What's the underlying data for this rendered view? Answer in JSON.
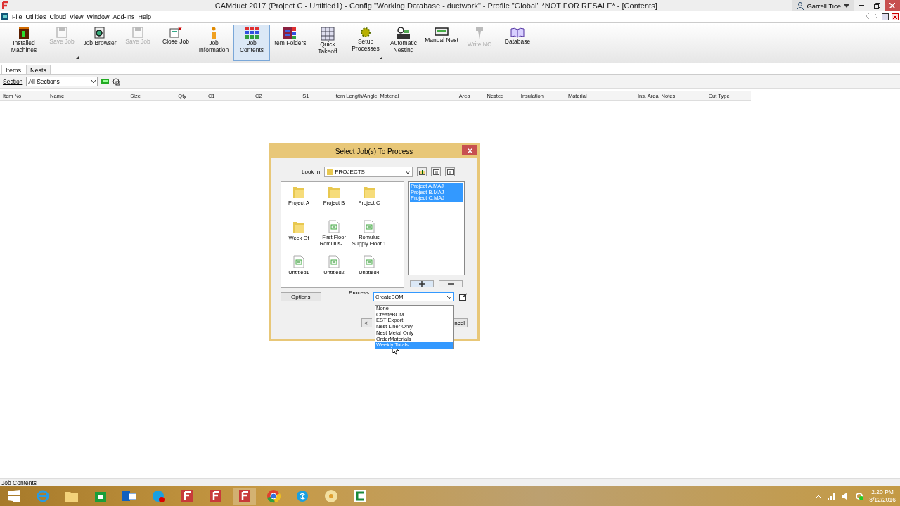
{
  "window": {
    "title": "CAMduct 2017 (Project C - Untitled1) - Config \"Working Database - ductwork\" - Profile \"Global\" *NOT FOR RESALE* - [Contents]",
    "user": "Garrell Tice"
  },
  "menu": [
    "File",
    "Utilities",
    "Cloud",
    "View",
    "Window",
    "Add-Ins",
    "Help"
  ],
  "toolbar": [
    {
      "label": "Installed Machines",
      "kind": "machine",
      "disabled": false,
      "selected": false,
      "dropdown": false
    },
    {
      "label": "Save Job",
      "kind": "save",
      "disabled": true,
      "selected": false,
      "dropdown": true
    },
    {
      "label": "Job Browser",
      "kind": "browser",
      "disabled": false,
      "selected": false,
      "dropdown": false
    },
    {
      "label": "Save Job",
      "kind": "save",
      "disabled": true,
      "selected": false,
      "dropdown": false
    },
    {
      "label": "Close Job",
      "kind": "close",
      "disabled": false,
      "selected": false,
      "dropdown": false
    },
    {
      "label": "Job Information",
      "kind": "info",
      "disabled": false,
      "selected": false,
      "dropdown": false
    },
    {
      "label": "Job Contents",
      "kind": "grid",
      "disabled": false,
      "selected": true,
      "dropdown": false
    },
    {
      "label": "Item Folders",
      "kind": "folders",
      "disabled": false,
      "selected": false,
      "dropdown": false
    },
    {
      "label": "Quick Takeoff",
      "kind": "takeoff",
      "disabled": false,
      "selected": false,
      "dropdown": false
    },
    {
      "label": "Setup Processes",
      "kind": "gear",
      "disabled": false,
      "selected": false,
      "dropdown": true
    },
    {
      "label": "Automatic Nesting",
      "kind": "nesting",
      "disabled": false,
      "selected": false,
      "dropdown": false
    },
    {
      "label": "Manual Nest",
      "kind": "manual",
      "disabled": false,
      "selected": false,
      "dropdown": false
    },
    {
      "label": "Write NC",
      "kind": "nc",
      "disabled": true,
      "selected": false,
      "dropdown": false
    },
    {
      "label": "Database",
      "kind": "database",
      "disabled": false,
      "selected": false,
      "dropdown": false
    }
  ],
  "tabs": [
    {
      "label": "Items",
      "selected": true
    },
    {
      "label": "Nests",
      "selected": false
    }
  ],
  "section": {
    "label": "Section",
    "value": "All Sections"
  },
  "columns": [
    "Item No",
    "Name",
    "Size",
    "Qty",
    "C1",
    "C2",
    "S1",
    "Item Length/Angle",
    "Material",
    "Area",
    "Nested",
    "Insulation",
    "Material",
    "Ins. Area",
    "Notes",
    "Cut Type"
  ],
  "dialog": {
    "title": "Select Job(s) To Process",
    "look_in_label": "Look In",
    "look_in_value": "PROJECTS",
    "files": [
      {
        "label": "Project A",
        "kind": "folder"
      },
      {
        "label": "Project B",
        "kind": "folder"
      },
      {
        "label": "Project C",
        "kind": "folder"
      },
      {
        "label": "Week Of",
        "kind": "folder"
      },
      {
        "label": "First Floor Romulus- ...",
        "kind": "job"
      },
      {
        "label": "Romulus Supply Floor 1",
        "kind": "job"
      },
      {
        "label": "Untitled1",
        "kind": "job"
      },
      {
        "label": "Untitled2",
        "kind": "job"
      },
      {
        "label": "Untitled4",
        "kind": "job"
      }
    ],
    "selected_jobs": [
      {
        "label": "Project A.MAJ",
        "selected": true
      },
      {
        "label": "Project B.MAJ",
        "selected": true
      },
      {
        "label": "Project C.MAJ",
        "selected": true
      }
    ],
    "options_button": "Options",
    "process_label": "Process",
    "process_value": "CreateBOM",
    "process_options": [
      {
        "label": "None",
        "selected": false
      },
      {
        "label": "CreateBOM",
        "selected": false
      },
      {
        "label": "EST Export",
        "selected": false
      },
      {
        "label": "Nest Liner Only",
        "selected": false
      },
      {
        "label": "Nest Metal Only",
        "selected": false
      },
      {
        "label": "OrderMaterials",
        "selected": false
      },
      {
        "label": "Weekly Totals",
        "selected": true
      }
    ],
    "buttons": [
      "<",
      "ncel"
    ]
  },
  "status_bar": "Job Contents",
  "clock": {
    "time": "2:20 PM",
    "date": "8/12/2016"
  }
}
